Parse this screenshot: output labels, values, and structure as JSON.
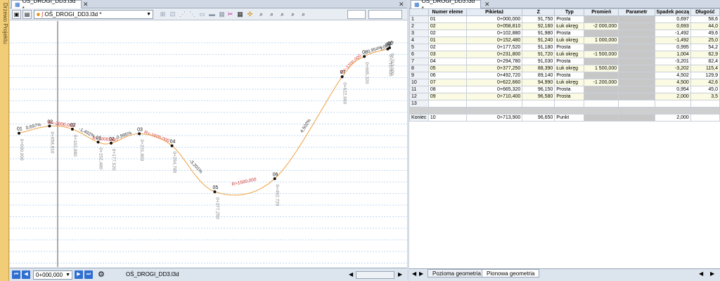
{
  "sidebar": {
    "label": "Drzewo Projektu"
  },
  "left_pane": {
    "tab_title": "OŚ_DROGI_DD3.l3d *",
    "toolbar": {
      "combo_value": "OŚ_DROGI_DD3.l3d *"
    },
    "status": {
      "station_value": "0+000,000",
      "file_name": "OŚ_DROGI_DD3.l3d"
    }
  },
  "right_pane": {
    "tab_title": "OŚ_DROGI_DD3.l3d *",
    "columns": [
      "",
      "Numer eleme",
      "Pikietaż",
      "Z",
      "Typ",
      "Promień",
      "Parametr",
      "Spadek począ",
      "Długość"
    ],
    "rows": [
      [
        "1",
        "01",
        "0+000,000",
        "91,750",
        "Prosta",
        "",
        "",
        "0,697",
        "58,6"
      ],
      [
        "2",
        "02",
        "0+058,810",
        "92,160",
        "Łuk okręg",
        "-2 000,000",
        "",
        "0,693",
        "44,0"
      ],
      [
        "3",
        "02",
        "0+102,880",
        "91,980",
        "Prosta",
        "",
        "",
        "-1,492",
        "49,6"
      ],
      [
        "4",
        "01",
        "0+152,480",
        "91,240",
        "Łuk okręg",
        "1 000,000",
        "",
        "-1,492",
        "25,0"
      ],
      [
        "5",
        "02",
        "0+177,520",
        "91,180",
        "Prosta",
        "",
        "",
        "0,995",
        "54,2"
      ],
      [
        "6",
        "03",
        "0+231,800",
        "91,720",
        "Łuk okręg",
        "-1 500,000",
        "",
        "1,004",
        "62,9"
      ],
      [
        "7",
        "04",
        "0+294,780",
        "91,030",
        "Prosta",
        "",
        "",
        "-3,201",
        "82,4"
      ],
      [
        "8",
        "05",
        "0+377,250",
        "88,390",
        "Łuk okręg",
        "1 500,000",
        "",
        "-3,202",
        "115,4"
      ],
      [
        "9",
        "06",
        "0+492,720",
        "89,140",
        "Prosta",
        "",
        "",
        "4,502",
        "129,9"
      ],
      [
        "10",
        "07",
        "0+622,660",
        "94,990",
        "Łuk okręg",
        "-1 200,000",
        "",
        "4,500",
        "42,6"
      ],
      [
        "11",
        "08",
        "0+665,320",
        "96,150",
        "Prosta",
        "",
        "",
        "0,954",
        "45,0"
      ],
      [
        "12",
        "09",
        "0+710,400",
        "96,580",
        "Prosta",
        "",
        "",
        "2,000",
        "3,5"
      ],
      [
        "13",
        "",
        "",
        "",
        "",
        "",
        "",
        "",
        ""
      ]
    ],
    "end_row": [
      "Koniec",
      "10",
      "0+713,900",
      "96,650",
      "Punkt",
      "",
      "",
      "2,000",
      ""
    ],
    "bottom_tabs": [
      "Pozioma geometria",
      "Pionowa geometria"
    ]
  },
  "profile": {
    "points": [
      {
        "x": 0,
        "z": 91.75,
        "label": "01",
        "st": "0+000,000",
        "seg": "0,697%"
      },
      {
        "x": 58.81,
        "z": 92.16,
        "label": "02",
        "st": "0+058,810",
        "seg": "R=-2000,000"
      },
      {
        "x": 102.88,
        "z": 91.98,
        "label": "02",
        "st": "0+102,880",
        "seg": "-1,492%"
      },
      {
        "x": 152.48,
        "z": 91.24,
        "label": "01",
        "st": "0+152,480",
        "seg": "R=1000,000"
      },
      {
        "x": 177.52,
        "z": 91.18,
        "label": "02",
        "st": "0+177,520",
        "seg": "0,995%"
      },
      {
        "x": 231.8,
        "z": 91.72,
        "label": "03",
        "st": "0+231,800",
        "seg": "R=-1500,000"
      },
      {
        "x": 294.78,
        "z": 91.03,
        "label": "04",
        "st": "0+294,780",
        "seg": "-3,201%"
      },
      {
        "x": 377.25,
        "z": 88.39,
        "label": "05",
        "st": "0+377,250",
        "seg": "R=1500,000"
      },
      {
        "x": 492.72,
        "z": 89.14,
        "label": "06",
        "st": "0+492,720",
        "seg": "4,502%"
      },
      {
        "x": 622.66,
        "z": 94.99,
        "label": "07",
        "st": "0+622,660",
        "seg": "R=-1200,000"
      },
      {
        "x": 665.32,
        "z": 96.15,
        "label": "08",
        "st": "0+665,320",
        "seg": "0,954%"
      },
      {
        "x": 710.4,
        "z": 96.58,
        "label": "09",
        "st": "0+710,400",
        "seg": "2,000%"
      },
      {
        "x": 713.9,
        "z": 96.65,
        "label": "10",
        "st": "0+713,900",
        "seg": ""
      }
    ]
  }
}
